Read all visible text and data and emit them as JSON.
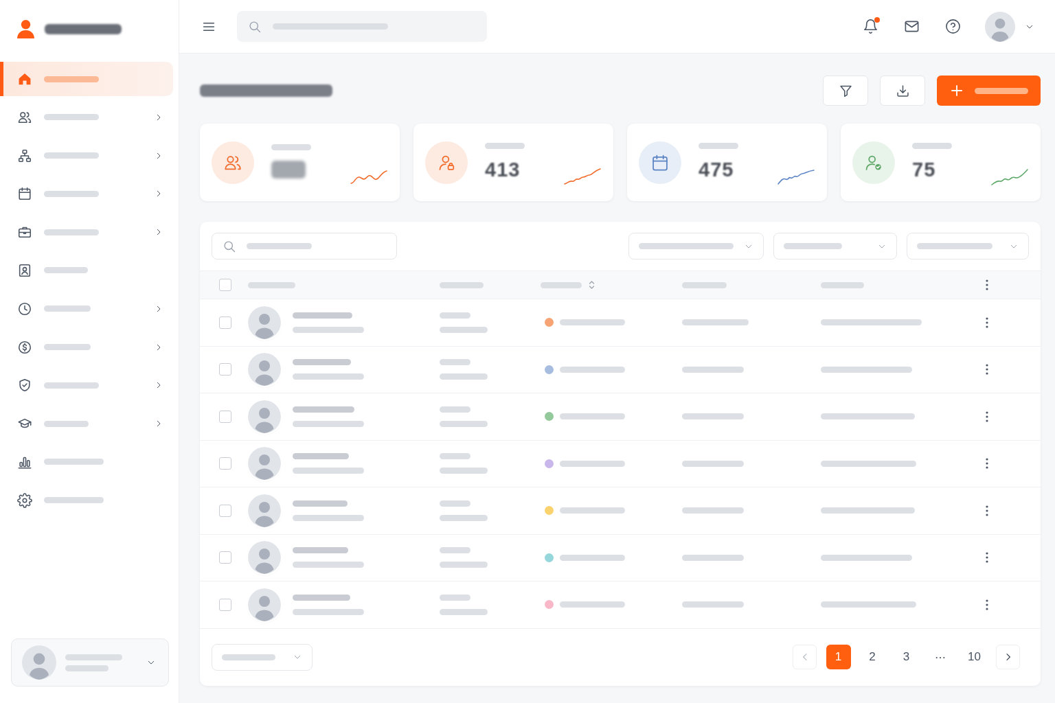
{
  "sidebar": {
    "items": [
      {
        "kind": "link",
        "selected": true
      },
      {
        "kind": "group",
        "selected": false
      },
      {
        "kind": "group",
        "selected": false
      },
      {
        "kind": "group",
        "selected": false
      },
      {
        "kind": "group",
        "selected": false
      },
      {
        "kind": "link",
        "selected": false
      },
      {
        "kind": "group",
        "selected": false
      },
      {
        "kind": "group",
        "selected": false
      },
      {
        "kind": "group",
        "selected": false
      },
      {
        "kind": "group",
        "selected": false
      },
      {
        "kind": "link",
        "selected": false
      },
      {
        "kind": "link",
        "selected": false
      }
    ]
  },
  "topbar": {
    "notifications": {
      "unread": true
    }
  },
  "stats": [
    {
      "color": "#f26b2b"
    },
    {
      "value": "413",
      "color": "#f26b2b"
    },
    {
      "value": "475",
      "color": "#5b84c4"
    },
    {
      "value": "75",
      "color": "#5ea868"
    }
  ],
  "table": {
    "select_all": {
      "checked": false
    },
    "columns": [
      {
        "sortable": false
      },
      {
        "sortable": false
      },
      {
        "sortable": true
      },
      {
        "sortable": false
      },
      {
        "sortable": false
      }
    ],
    "rows": [
      {
        "checked": false,
        "color": "#f7a373"
      },
      {
        "checked": false,
        "color": "#a7bde0"
      },
      {
        "checked": false,
        "color": "#93c99b"
      },
      {
        "checked": false,
        "color": "#c9b6ea"
      },
      {
        "checked": false,
        "color": "#fad36e"
      },
      {
        "checked": false,
        "color": "#95d7da"
      },
      {
        "checked": false,
        "color": "#f8b8c8"
      }
    ]
  },
  "pagination": {
    "previous": {
      "disabled": true
    },
    "pages": [
      {
        "kind": "page",
        "label": "1",
        "selected": true
      },
      {
        "kind": "page",
        "label": "2",
        "selected": false
      },
      {
        "kind": "page",
        "label": "3",
        "selected": false
      },
      {
        "kind": "ellipsis",
        "label": "⋯",
        "selected": false
      },
      {
        "kind": "page",
        "label": "10",
        "selected": false
      }
    ],
    "next": {
      "disabled": false
    }
  }
}
